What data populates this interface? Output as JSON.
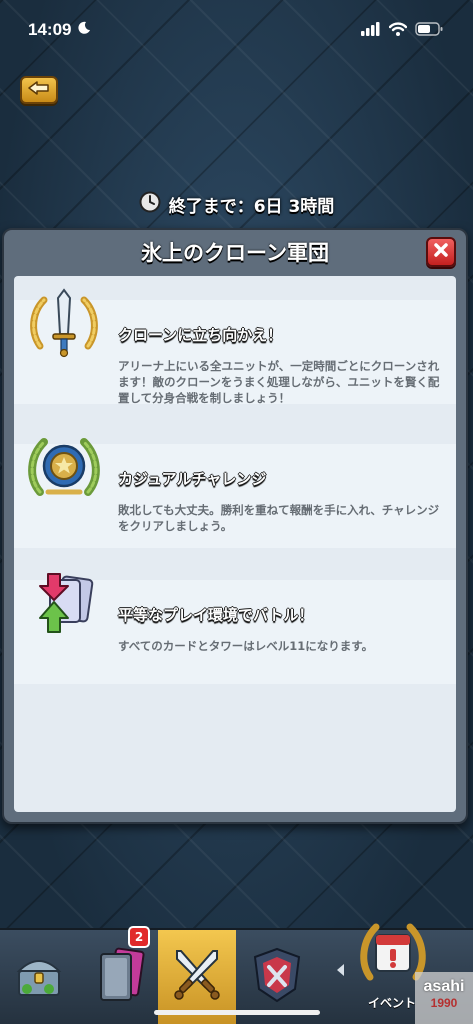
{
  "status_bar": {
    "time": "14:09"
  },
  "timer": {
    "text": "終了まで：6日 3時間"
  },
  "modal": {
    "title": "氷上のクローン軍団",
    "features": [
      {
        "icon": "sword-laurel-icon",
        "title": "クローンに立ち向かえ！",
        "description": "アリーナ上にいる全ユニットが、一定時間ごとにクローンされます！敵のクローンをうまく処理しながら、ユニットを賢く配置して分身合戦を制しましょう！"
      },
      {
        "icon": "casual-laurel-icon",
        "title": "カジュアルチャレンジ",
        "description": "敗北しても大丈夫。勝利を重ねて報酬を手に入れ、チャレンジをクリアしましょう。"
      },
      {
        "icon": "card-arrows-icon",
        "title": "平等なプレイ環境でバトル！",
        "description": "すべてのカードとタワーはレベル11になります。"
      }
    ]
  },
  "bottom_nav": {
    "cards_badge": "2",
    "event_label": "イベント"
  },
  "watermark": {
    "line1": "asahi",
    "line2": "1990"
  }
}
